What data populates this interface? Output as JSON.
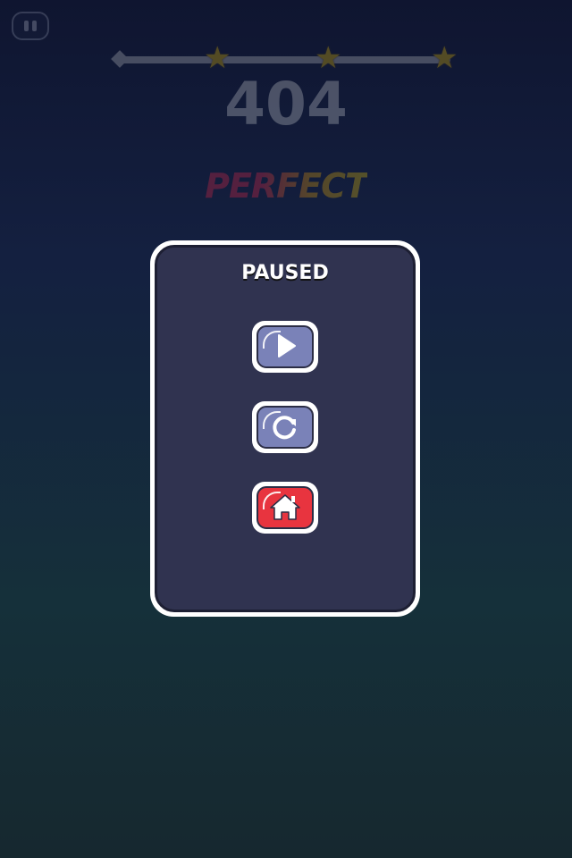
{
  "hud": {
    "score": "404",
    "grade": "PERFECT",
    "progress_stars": 3,
    "progress_fraction": 1.0
  },
  "pause_menu": {
    "title": "PAUSED",
    "buttons": [
      {
        "name": "resume",
        "icon": "play-icon"
      },
      {
        "name": "restart",
        "icon": "restart-icon"
      },
      {
        "name": "home",
        "icon": "home-icon"
      }
    ]
  },
  "colors": {
    "panel_fill": "#303350",
    "button_blue": "#7a82b8",
    "button_red": "#e8343f",
    "star": "#ffd000"
  }
}
